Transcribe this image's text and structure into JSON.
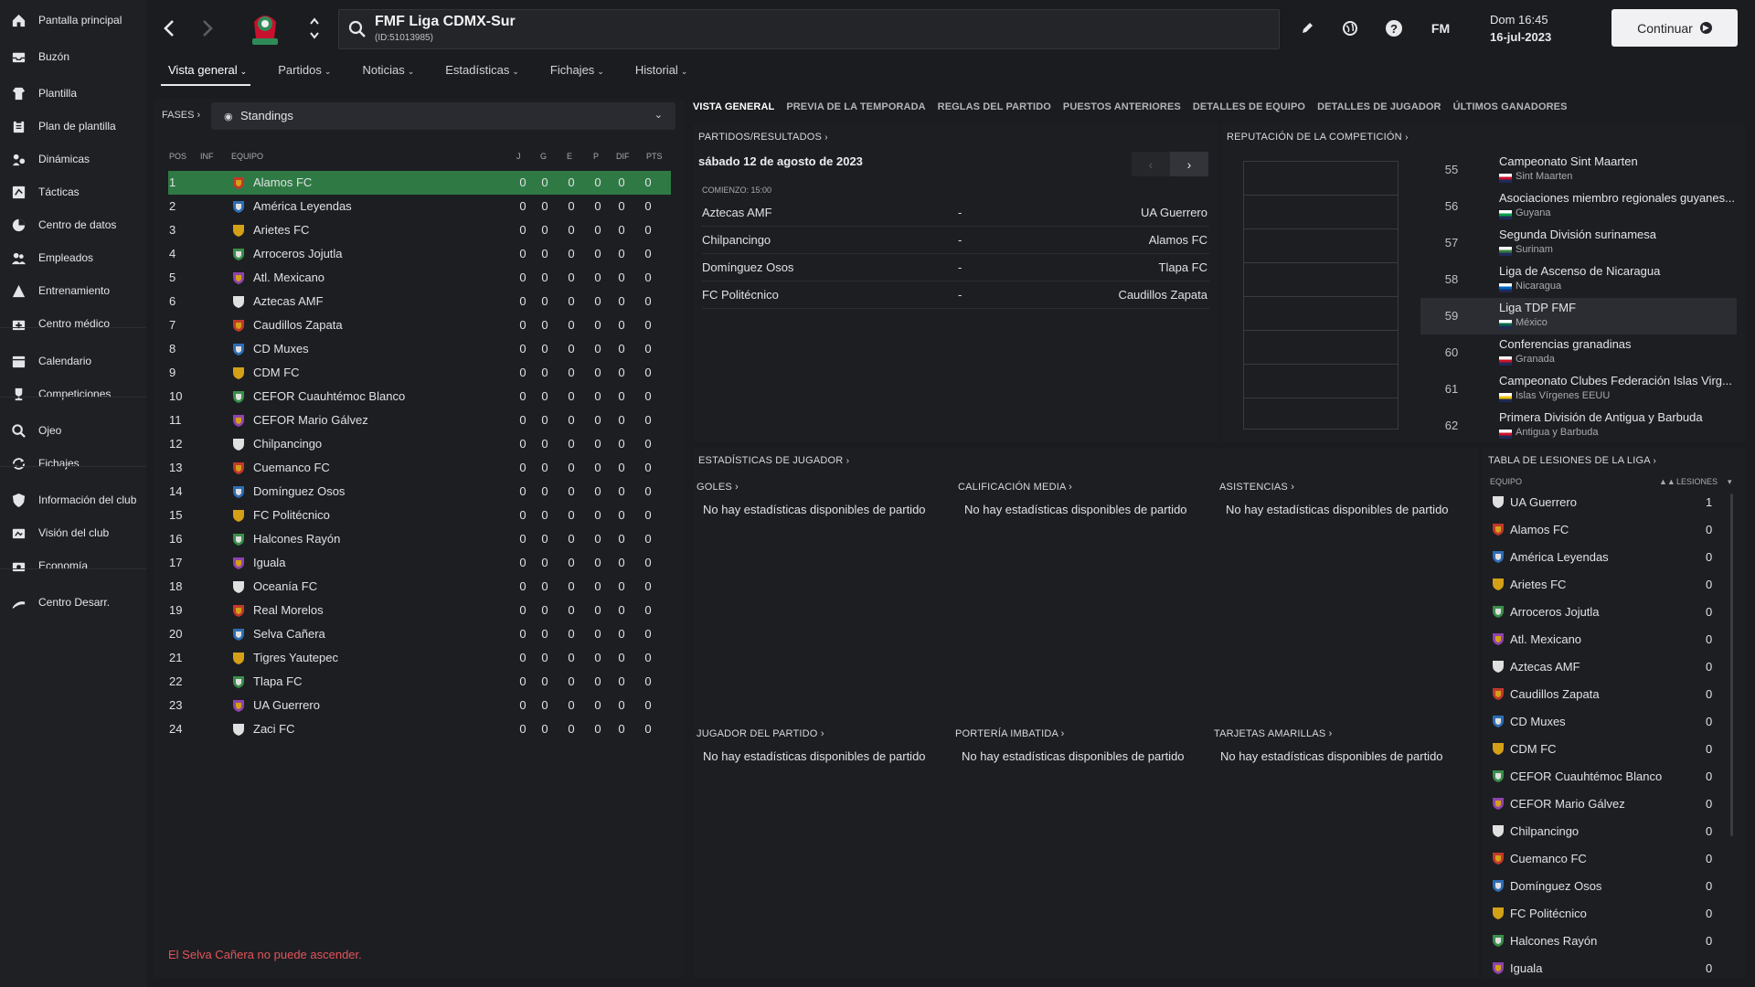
{
  "sidebar": {
    "items": [
      {
        "label": "Pantalla principal",
        "icon": "home-icon"
      },
      {
        "label": "Buzón",
        "icon": "inbox-icon"
      },
      {
        "label": "Plantilla",
        "icon": "squad-icon"
      },
      {
        "label": "Plan de plantilla",
        "icon": "clipboard-icon"
      },
      {
        "label": "Dinámicas",
        "icon": "dynamics-icon"
      },
      {
        "label": "Tácticas",
        "icon": "tactics-icon"
      },
      {
        "label": "Centro de datos",
        "icon": "data-icon"
      },
      {
        "label": "Empleados",
        "icon": "staff-icon"
      },
      {
        "label": "Entrenamiento",
        "icon": "training-icon"
      },
      {
        "label": "Centro médico",
        "icon": "medical-icon"
      },
      {
        "label": "Calendario",
        "icon": "calendar-icon"
      },
      {
        "label": "Competiciones",
        "icon": "trophy-icon"
      },
      {
        "label": "Ojeo",
        "icon": "scouting-icon"
      },
      {
        "label": "Fichajes",
        "icon": "transfers-icon"
      },
      {
        "label": "Información del club",
        "icon": "shield-icon"
      },
      {
        "label": "Visión del club",
        "icon": "vision-icon"
      },
      {
        "label": "Economía",
        "icon": "finance-icon"
      },
      {
        "label": "Centro Desarr.",
        "icon": "development-icon"
      }
    ]
  },
  "header": {
    "competition": "FMF Liga CDMX-Sur",
    "competition_id": "(ID:51013985)",
    "fm_label": "FM",
    "day_time": "Dom 16:45",
    "date": "16-jul-2023",
    "continue_label": "Continuar"
  },
  "main_tabs": [
    {
      "label": "Vista general",
      "active": true
    },
    {
      "label": "Partidos",
      "active": false
    },
    {
      "label": "Noticias",
      "active": false
    },
    {
      "label": "Estadísticas",
      "active": false
    },
    {
      "label": "Fichajes",
      "active": false
    },
    {
      "label": "Historial",
      "active": false
    }
  ],
  "standings": {
    "fases_label": "FASES",
    "view_selected": "Standings",
    "columns": [
      "POS",
      "INF",
      "EQUIPO",
      "J",
      "G",
      "E",
      "P",
      "DIF",
      "PTS"
    ],
    "rows": [
      {
        "pos": "1",
        "team": "Alamos FC",
        "j": "0",
        "g": "0",
        "e": "0",
        "p": "0",
        "dif": "0",
        "pts": "0"
      },
      {
        "pos": "2",
        "team": "América Leyendas",
        "j": "0",
        "g": "0",
        "e": "0",
        "p": "0",
        "dif": "0",
        "pts": "0"
      },
      {
        "pos": "3",
        "team": "Arietes FC",
        "j": "0",
        "g": "0",
        "e": "0",
        "p": "0",
        "dif": "0",
        "pts": "0"
      },
      {
        "pos": "4",
        "team": "Arroceros Jojutla",
        "j": "0",
        "g": "0",
        "e": "0",
        "p": "0",
        "dif": "0",
        "pts": "0"
      },
      {
        "pos": "5",
        "team": "Atl. Mexicano",
        "j": "0",
        "g": "0",
        "e": "0",
        "p": "0",
        "dif": "0",
        "pts": "0"
      },
      {
        "pos": "6",
        "team": "Aztecas AMF",
        "j": "0",
        "g": "0",
        "e": "0",
        "p": "0",
        "dif": "0",
        "pts": "0"
      },
      {
        "pos": "7",
        "team": "Caudillos Zapata",
        "j": "0",
        "g": "0",
        "e": "0",
        "p": "0",
        "dif": "0",
        "pts": "0"
      },
      {
        "pos": "8",
        "team": "CD Muxes",
        "j": "0",
        "g": "0",
        "e": "0",
        "p": "0",
        "dif": "0",
        "pts": "0"
      },
      {
        "pos": "9",
        "team": "CDM FC",
        "j": "0",
        "g": "0",
        "e": "0",
        "p": "0",
        "dif": "0",
        "pts": "0"
      },
      {
        "pos": "10",
        "team": "CEFOR Cuauhtémoc Blanco",
        "j": "0",
        "g": "0",
        "e": "0",
        "p": "0",
        "dif": "0",
        "pts": "0"
      },
      {
        "pos": "11",
        "team": "CEFOR Mario Gálvez",
        "j": "0",
        "g": "0",
        "e": "0",
        "p": "0",
        "dif": "0",
        "pts": "0"
      },
      {
        "pos": "12",
        "team": "Chilpancingo",
        "j": "0",
        "g": "0",
        "e": "0",
        "p": "0",
        "dif": "0",
        "pts": "0"
      },
      {
        "pos": "13",
        "team": "Cuemanco FC",
        "j": "0",
        "g": "0",
        "e": "0",
        "p": "0",
        "dif": "0",
        "pts": "0"
      },
      {
        "pos": "14",
        "team": "Domínguez Osos",
        "j": "0",
        "g": "0",
        "e": "0",
        "p": "0",
        "dif": "0",
        "pts": "0"
      },
      {
        "pos": "15",
        "team": "FC Politécnico",
        "j": "0",
        "g": "0",
        "e": "0",
        "p": "0",
        "dif": "0",
        "pts": "0"
      },
      {
        "pos": "16",
        "team": "Halcones Rayón",
        "j": "0",
        "g": "0",
        "e": "0",
        "p": "0",
        "dif": "0",
        "pts": "0"
      },
      {
        "pos": "17",
        "team": "Iguala",
        "j": "0",
        "g": "0",
        "e": "0",
        "p": "0",
        "dif": "0",
        "pts": "0"
      },
      {
        "pos": "18",
        "team": "Oceanía FC",
        "j": "0",
        "g": "0",
        "e": "0",
        "p": "0",
        "dif": "0",
        "pts": "0"
      },
      {
        "pos": "19",
        "team": "Real Morelos",
        "j": "0",
        "g": "0",
        "e": "0",
        "p": "0",
        "dif": "0",
        "pts": "0"
      },
      {
        "pos": "20",
        "team": "Selva Cañera",
        "j": "0",
        "g": "0",
        "e": "0",
        "p": "0",
        "dif": "0",
        "pts": "0"
      },
      {
        "pos": "21",
        "team": "Tigres Yautepec",
        "j": "0",
        "g": "0",
        "e": "0",
        "p": "0",
        "dif": "0",
        "pts": "0"
      },
      {
        "pos": "22",
        "team": "Tlapa FC",
        "j": "0",
        "g": "0",
        "e": "0",
        "p": "0",
        "dif": "0",
        "pts": "0"
      },
      {
        "pos": "23",
        "team": "UA Guerrero",
        "j": "0",
        "g": "0",
        "e": "0",
        "p": "0",
        "dif": "0",
        "pts": "0"
      },
      {
        "pos": "24",
        "team": "Zaci FC",
        "j": "0",
        "g": "0",
        "e": "0",
        "p": "0",
        "dif": "0",
        "pts": "0"
      }
    ],
    "warning": "El Selva Cañera no puede ascender."
  },
  "sub_tabs": [
    {
      "label": "VISTA GENERAL",
      "active": true
    },
    {
      "label": "PREVIA DE LA TEMPORADA",
      "active": false
    },
    {
      "label": "REGLAS DEL PARTIDO",
      "active": false
    },
    {
      "label": "PUESTOS ANTERIORES",
      "active": false
    },
    {
      "label": "DETALLES DE EQUIPO",
      "active": false
    },
    {
      "label": "DETALLES DE JUGADOR",
      "active": false
    },
    {
      "label": "ÚLTIMOS GANADORES",
      "active": false
    }
  ],
  "fixtures": {
    "title": "PARTIDOS/RESULTADOS",
    "date": "sábado 12 de agosto de 2023",
    "start_label": "COMIENZO: 15:00",
    "matches": [
      {
        "home": "Aztecas AMF",
        "sep": "-",
        "away": "UA Guerrero"
      },
      {
        "home": "Chilpancingo",
        "sep": "-",
        "away": "Alamos FC"
      },
      {
        "home": "Domínguez Osos",
        "sep": "-",
        "away": "Tlapa FC"
      },
      {
        "home": "FC Politécnico",
        "sep": "-",
        "away": "Caudillos Zapata"
      }
    ]
  },
  "reputation": {
    "title": "REPUTACIÓN DE LA COMPETICIÓN",
    "items": [
      {
        "rank": "55",
        "name": "Campeonato Sint Maarten",
        "country": "Sint Maarten",
        "flag_color": "#c8102e"
      },
      {
        "rank": "56",
        "name": "Asociaciones miembro regionales guyanes...",
        "country": "Guyana",
        "flag_color": "#009e49"
      },
      {
        "rank": "57",
        "name": "Segunda División surinamesa",
        "country": "Surinam",
        "flag_color": "#377e3f"
      },
      {
        "rank": "58",
        "name": "Liga de Ascenso de Nicaragua",
        "country": "Nicaragua",
        "flag_color": "#0067c6"
      },
      {
        "rank": "59",
        "name": "Liga TDP FMF",
        "country": "México",
        "flag_color": "#006847",
        "highlight": true
      },
      {
        "rank": "60",
        "name": "Conferencias granadinas",
        "country": "Granada",
        "flag_color": "#ce1126"
      },
      {
        "rank": "61",
        "name": "Campeonato Clubes Federación Islas Virg...",
        "country": "Islas Vírgenes EEUU",
        "flag_color": "#f2c200"
      },
      {
        "rank": "62",
        "name": "Primera División de Antigua y Barbuda",
        "country": "Antigua y Barbuda",
        "flag_color": "#ce1126"
      }
    ]
  },
  "player_stats": {
    "title": "ESTADÍSTICAS DE JUGADOR",
    "blocks": [
      {
        "title": "GOLES",
        "value": "No hay estadísticas disponibles de partido"
      },
      {
        "title": "CALIFICACIÓN MEDIA",
        "value": "No hay estadísticas disponibles de partido"
      },
      {
        "title": "ASISTENCIAS",
        "value": "No hay estadísticas disponibles de partido"
      },
      {
        "title": "JUGADOR DEL PARTIDO",
        "value": "No hay estadísticas disponibles de partido"
      },
      {
        "title": "PORTERÍA IMBATIDA",
        "value": "No hay estadísticas disponibles de partido"
      },
      {
        "title": "TARJETAS AMARILLAS",
        "value": "No hay estadísticas disponibles de partido"
      }
    ]
  },
  "injuries": {
    "title": "TABLA DE LESIONES DE LA LIGA",
    "col_team": "EQUIPO",
    "col_injuries": "LESIONES",
    "rows": [
      {
        "team": "UA Guerrero",
        "value": "1"
      },
      {
        "team": "Alamos FC",
        "value": "0"
      },
      {
        "team": "América Leyendas",
        "value": "0"
      },
      {
        "team": "Arietes FC",
        "value": "0"
      },
      {
        "team": "Arroceros Jojutla",
        "value": "0"
      },
      {
        "team": "Atl. Mexicano",
        "value": "0"
      },
      {
        "team": "Aztecas AMF",
        "value": "0"
      },
      {
        "team": "Caudillos Zapata",
        "value": "0"
      },
      {
        "team": "CD Muxes",
        "value": "0"
      },
      {
        "team": "CDM FC",
        "value": "0"
      },
      {
        "team": "CEFOR Cuauhtémoc Blanco",
        "value": "0"
      },
      {
        "team": "CEFOR Mario Gálvez",
        "value": "0"
      },
      {
        "team": "Chilpancingo",
        "value": "0"
      },
      {
        "team": "Cuemanco FC",
        "value": "0"
      },
      {
        "team": "Domínguez Osos",
        "value": "0"
      },
      {
        "team": "FC Politécnico",
        "value": "0"
      },
      {
        "team": "Halcones Rayón",
        "value": "0"
      },
      {
        "team": "Iguala",
        "value": "0"
      }
    ]
  },
  "colors": {
    "highlight_row": "#2f7a44",
    "warning": "#e3545a",
    "crest_palette": [
      "#c0392b",
      "#2e6db4",
      "#d4a017",
      "#3a8f4a",
      "#8e44ad",
      "#e0e0e0"
    ]
  }
}
